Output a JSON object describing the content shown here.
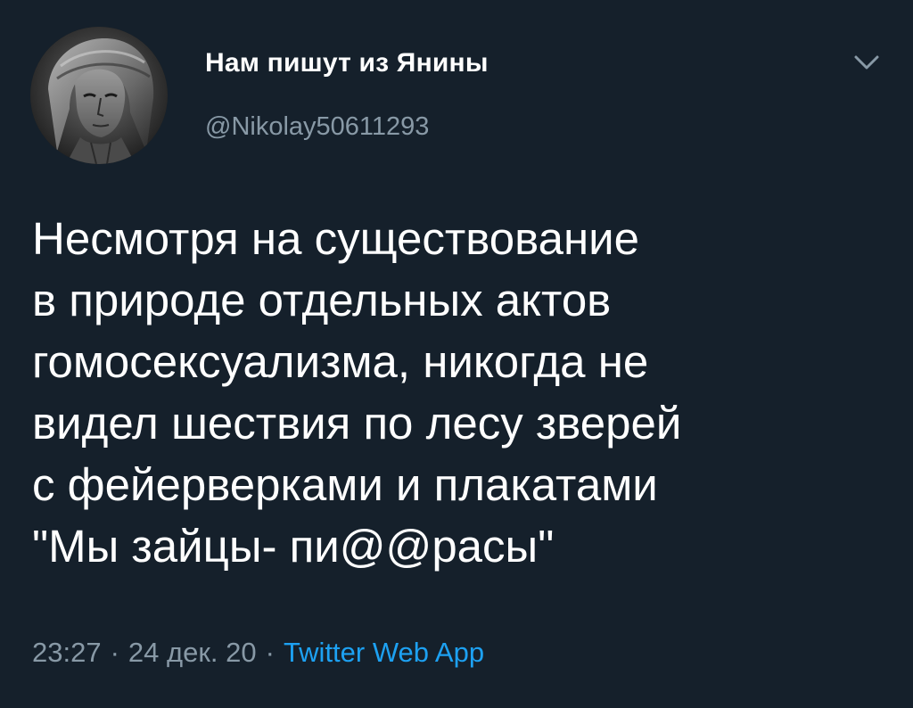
{
  "tweet": {
    "author": {
      "display_name": "Нам пишут из Янины",
      "handle": "@Nikolay50611293",
      "avatar_icon": "profile-photo-avatar"
    },
    "menu_icon": "chevron-down-icon",
    "text_lines": [
      "Несмотря на существование",
      "в природе отдельных актов",
      "гомосексуализма, никогда не",
      "видел шествия по лесу зверей",
      "с фейерверками и плакатами",
      "\"Мы зайцы- пи@@расы\""
    ],
    "meta": {
      "time": "23:27",
      "separator": "·",
      "date": "24 дек. 20",
      "source": "Twitter Web App"
    },
    "colors": {
      "background": "#15202b",
      "text": "#ffffff",
      "secondary": "#8899a6",
      "link": "#1da1f2"
    }
  }
}
